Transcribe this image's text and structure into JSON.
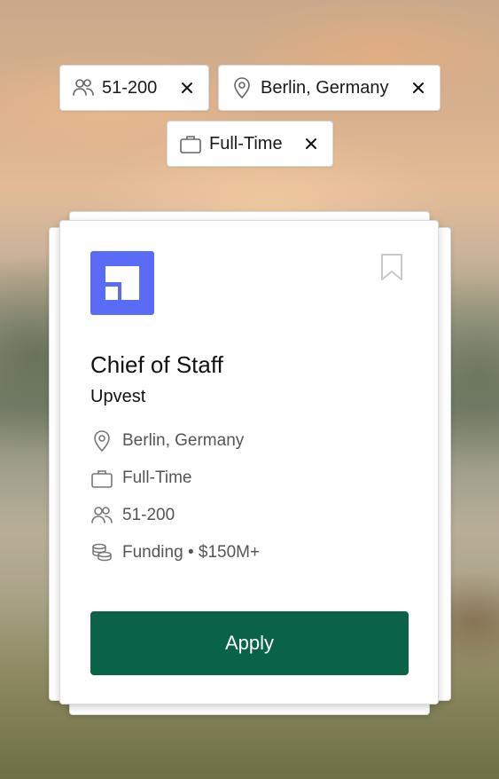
{
  "filters": [
    {
      "icon": "people-icon",
      "label": "51-200"
    },
    {
      "icon": "location-pin-icon",
      "label": "Berlin, Germany"
    },
    {
      "icon": "briefcase-icon",
      "label": "Full-Time"
    }
  ],
  "job": {
    "logo_icon": "company-logo",
    "title": "Chief of Staff",
    "company": "Upvest",
    "location": "Berlin, Germany",
    "employment_type": "Full-Time",
    "company_size": "51-200",
    "funding": "Funding • $150M+",
    "apply_label": "Apply"
  },
  "colors": {
    "accent_button": "#0b6347",
    "logo_background": "#5a6cf5"
  }
}
